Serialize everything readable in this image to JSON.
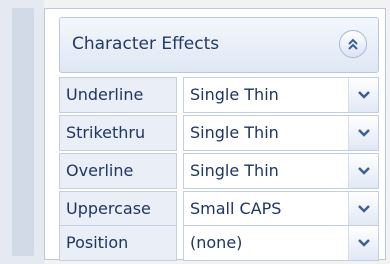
{
  "panel": {
    "title": "Character Effects"
  },
  "rows": [
    {
      "label": "Underline",
      "value": "Single Thin"
    },
    {
      "label": "Strikethru",
      "value": "Single Thin"
    },
    {
      "label": "Overline",
      "value": "Single Thin"
    },
    {
      "label": "Uppercase",
      "value": "Small CAPS"
    },
    {
      "label": "Position",
      "value": "(none)"
    }
  ],
  "icons": {
    "collapse": "double-chevron-up-icon",
    "dropdown": "chevron-down-icon"
  },
  "colors": {
    "label_background": "#e9eef7",
    "border": "#c2cee4",
    "text": "#1f3562",
    "chevron": "#3f5f93"
  }
}
